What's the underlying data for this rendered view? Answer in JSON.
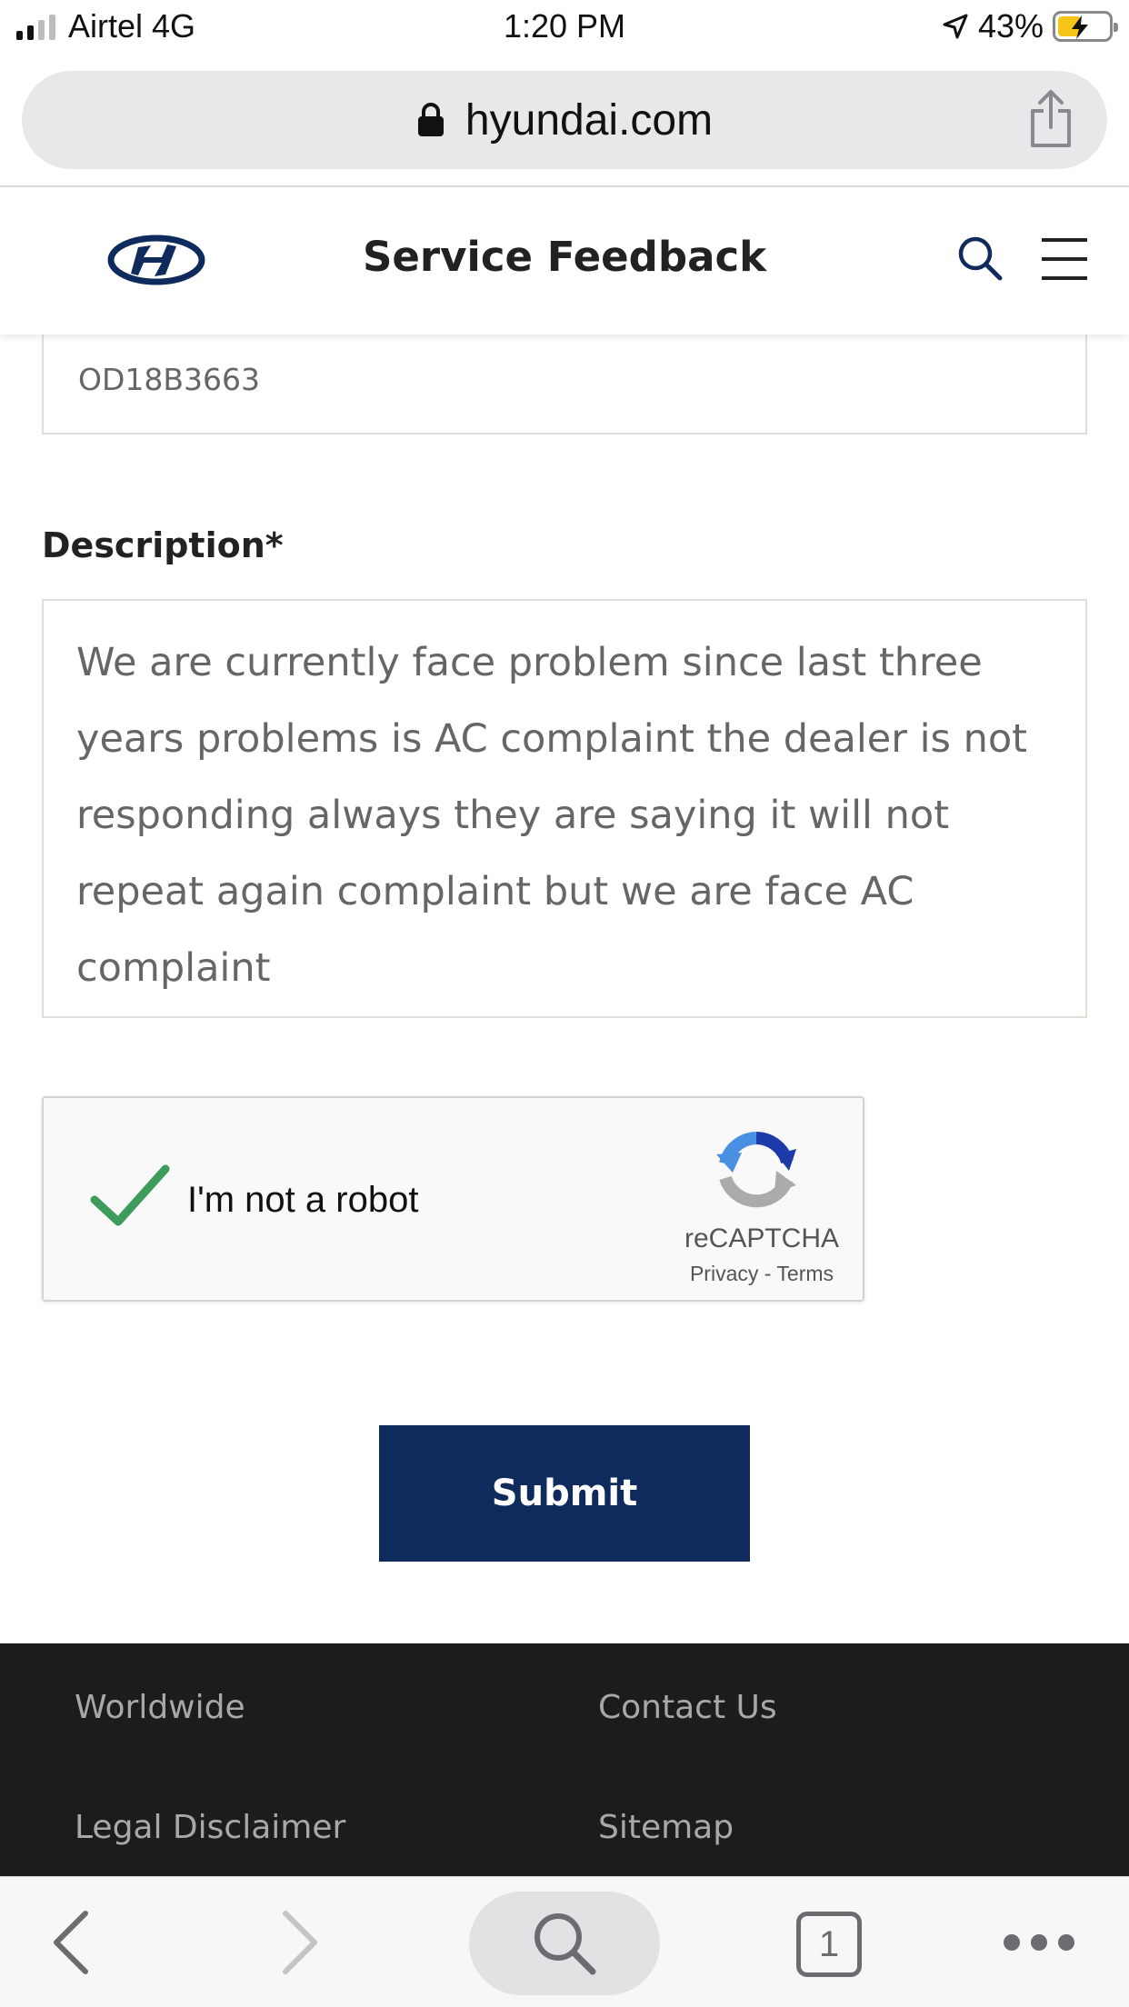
{
  "status_bar": {
    "carrier": "Airtel 4G",
    "time": "1:20 PM",
    "battery_percent": "43%"
  },
  "browser": {
    "url": "hyundai.com"
  },
  "header": {
    "title": "Service Feedback"
  },
  "form": {
    "previous_field_value": "OD18B3663",
    "description_label": "Description*",
    "description_value": "We are currently face problem since last three years problems is AC complaint the dealer is not responding always they are saying it will not repeat again complaint but we are face AC complaint",
    "submit_label": "Submit"
  },
  "recaptcha": {
    "label": "I'm not a robot",
    "brand": "reCAPTCHA",
    "privacy": "Privacy",
    "separator": " - ",
    "terms": "Terms",
    "checked": true
  },
  "footer": {
    "links": [
      "Worldwide",
      "Contact Us",
      "Legal Disclaimer",
      "Sitemap"
    ]
  },
  "toolbar": {
    "tab_count": "1"
  },
  "colors": {
    "brand_navy": "#0f2a5c",
    "footer_bg": "#1c1c1c",
    "check_green": "#3d9b5c"
  },
  "icons": [
    "lock-icon",
    "share-icon",
    "hyundai-logo",
    "search-icon",
    "menu-icon",
    "back-icon",
    "forward-icon",
    "tabs-icon",
    "more-icon"
  ]
}
